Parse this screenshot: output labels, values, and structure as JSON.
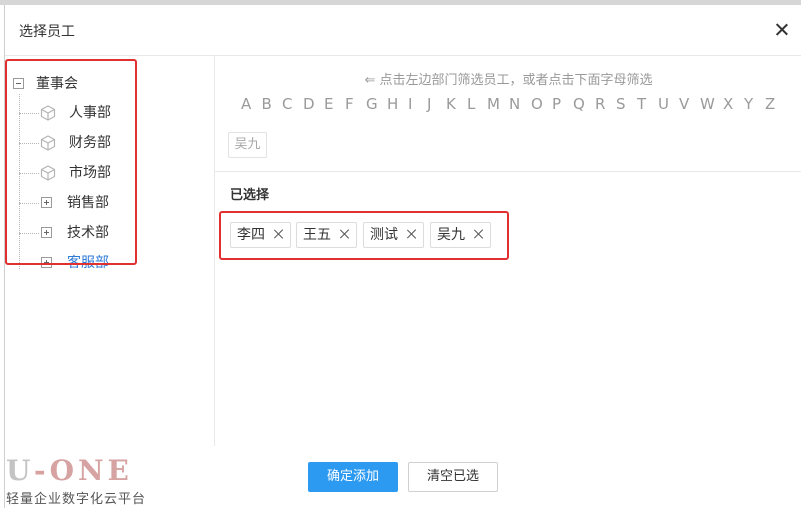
{
  "dialog": {
    "title": "选择员工"
  },
  "tree": {
    "root": {
      "label": "董事会",
      "icon": "minus-box-icon"
    },
    "items": [
      {
        "label": "人事部",
        "icon": "cube-icon",
        "type": "leaf"
      },
      {
        "label": "财务部",
        "icon": "cube-icon",
        "type": "leaf"
      },
      {
        "label": "市场部",
        "icon": "cube-icon",
        "type": "leaf"
      },
      {
        "label": "销售部",
        "icon": "plus-box-icon",
        "type": "expandable"
      },
      {
        "label": "技术部",
        "icon": "plus-box-icon",
        "type": "expandable"
      },
      {
        "label": "客服部",
        "icon": "plus-box-icon",
        "type": "expandable",
        "selected": true
      }
    ]
  },
  "filter": {
    "hint": "⇐ 点击左边部门筛选员工，或者点击下面字母筛选",
    "letters": [
      "A",
      "B",
      "C",
      "D",
      "E",
      "F",
      "G",
      "H",
      "I",
      "J",
      "K",
      "L",
      "M",
      "N",
      "O",
      "P",
      "Q",
      "R",
      "S",
      "T",
      "U",
      "V",
      "W",
      "X",
      "Y",
      "Z"
    ]
  },
  "employees": [
    {
      "name": "吴九"
    }
  ],
  "selected": {
    "title": "已选择",
    "tags": [
      {
        "name": "李四"
      },
      {
        "name": "王五"
      },
      {
        "name": "测试"
      },
      {
        "name": "吴九"
      }
    ]
  },
  "footer": {
    "confirm_label": "确定添加",
    "clear_label": "清空已选"
  },
  "watermark": {
    "logo": {
      "u": "U",
      "dash": "-",
      "one": "ONE"
    },
    "subtitle": "轻量企业数字化云平台"
  },
  "colors": {
    "primary": "#2d9af2",
    "highlight": "#e03030",
    "selected_text": "#2d7ad6"
  }
}
